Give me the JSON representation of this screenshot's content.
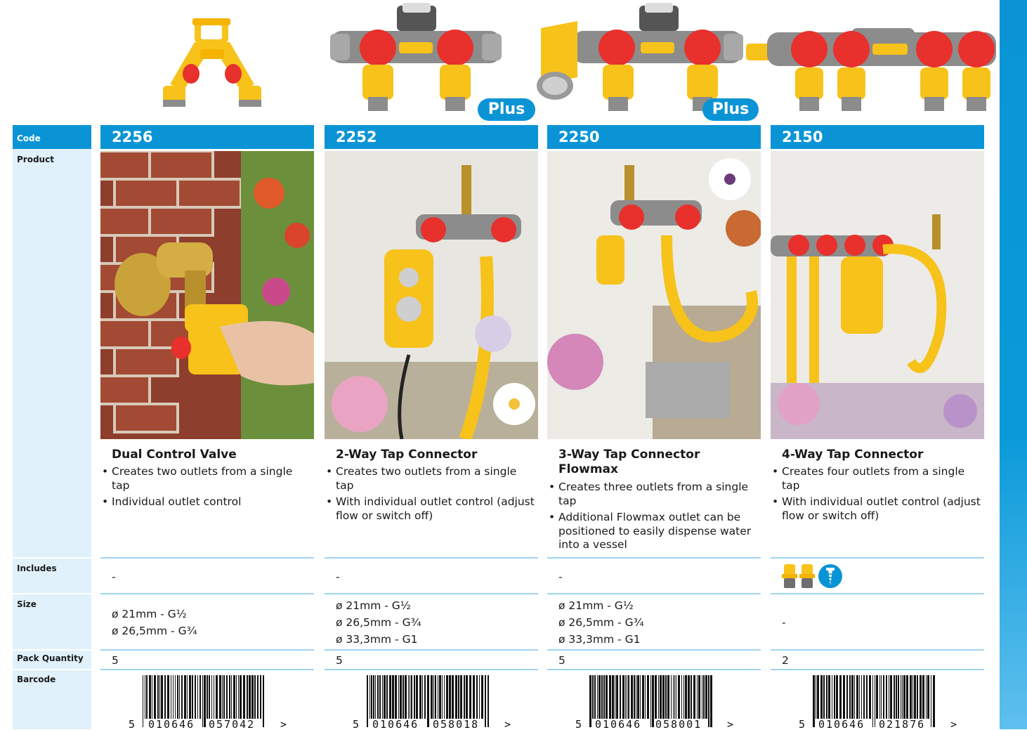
{
  "labels": {
    "code": "Code",
    "product": "Product",
    "includes": "Includes",
    "size": "Size",
    "pack_quantity": "Pack Quantity",
    "barcode": "Barcode"
  },
  "plus_badge": "Plus",
  "products": [
    {
      "code": "2256",
      "name": "Dual Control Valve",
      "bullets": [
        "Creates two outlets from a single tap",
        "Individual outlet control"
      ],
      "includes": "-",
      "sizes": [
        "ø 21mm - G½",
        "ø 26,5mm - G¾"
      ],
      "pack_quantity": "5",
      "barcode": {
        "lead": "5",
        "left": "010646",
        "right": "057042",
        "arrow": ">"
      }
    },
    {
      "code": "2252",
      "name": "2-Way Tap Connector",
      "bullets": [
        "Creates two outlets from a single tap",
        "With individual outlet control (adjust flow or switch off)"
      ],
      "includes": "-",
      "sizes": [
        "ø 21mm - G½",
        "ø 26,5mm - G¾",
        "ø 33,3mm - G1"
      ],
      "pack_quantity": "5",
      "barcode": {
        "lead": "5",
        "left": "010646",
        "right": "058018",
        "arrow": ">"
      }
    },
    {
      "code": "2250",
      "name": "3-Way Tap Connector Flowmax",
      "bullets": [
        "Creates three outlets from a single tap",
        "Additional Flowmax outlet can be positioned to easily dispense water into a vessel"
      ],
      "includes": "-",
      "sizes": [
        "ø 21mm - G½",
        "ø 26,5mm - G¾",
        "ø 33,3mm - G1"
      ],
      "pack_quantity": "5",
      "barcode": {
        "lead": "5",
        "left": "010646",
        "right": "058001",
        "arrow": ">"
      }
    },
    {
      "code": "2150",
      "name": "4-Way Tap Connector",
      "bullets": [
        "Creates four outlets from a single tap",
        "With individual outlet control (adjust flow or switch off)"
      ],
      "includes": "",
      "includes_icons": [
        "hose-connector-icon",
        "hose-connector-icon",
        "screw-icon"
      ],
      "sizes": [
        "-"
      ],
      "pack_quantity": "2",
      "barcode": {
        "lead": "5",
        "left": "010646",
        "right": "021876",
        "arrow": ">"
      }
    }
  ],
  "colors": {
    "accent_blue": "#0a94d6",
    "label_bg": "#e0f1fb",
    "product_yellow": "#f7c21a",
    "product_red": "#e8302c",
    "product_grey": "#8c8c8c"
  }
}
